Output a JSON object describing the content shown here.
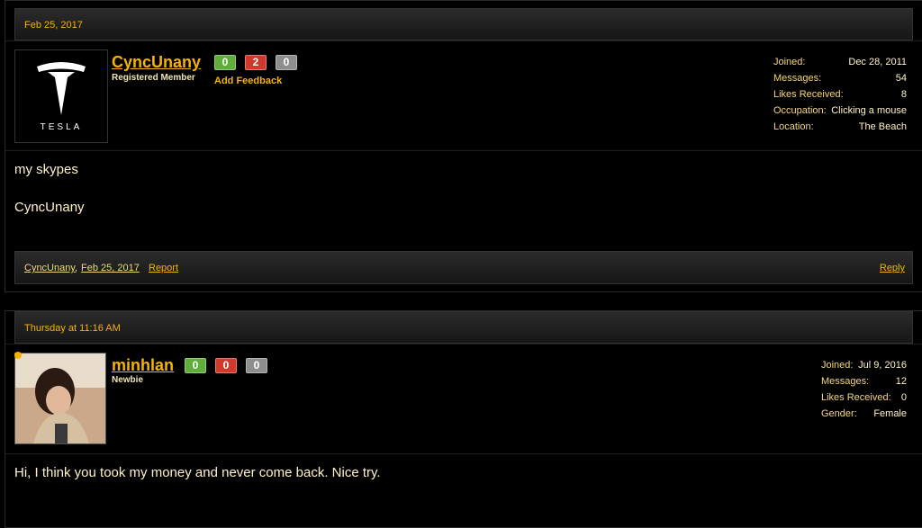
{
  "posts": [
    {
      "date": "Feb 25, 2017",
      "username": "CyncUnany",
      "role": "Registered Member",
      "avatar_label": "TESLA",
      "badges": [
        "0",
        "2",
        "0"
      ],
      "add_feedback": "Add Feedback",
      "stats": [
        {
          "label": "Joined:",
          "value": "Dec 28, 2011"
        },
        {
          "label": "Messages:",
          "value": "54"
        },
        {
          "label": "Likes Received:",
          "value": "8"
        },
        {
          "label": "Occupation:",
          "value": "Clicking a mouse"
        },
        {
          "label": "Location:",
          "value": "The Beach"
        }
      ],
      "message_lines": [
        "my skypes",
        "CyncUnany"
      ],
      "footer": {
        "author": "CyncUnany",
        "separator": ",",
        "date": "Feb 25, 2017",
        "report": "Report",
        "reply": "Reply"
      }
    },
    {
      "date": "Thursday at 11:16 AM",
      "username": "minhlan",
      "role": "Newbie",
      "badges": [
        "0",
        "0",
        "0"
      ],
      "stats": [
        {
          "label": "Joined:",
          "value": "Jul 9, 2016"
        },
        {
          "label": "Messages:",
          "value": "12"
        },
        {
          "label": "Likes Received:",
          "value": "0"
        },
        {
          "label": "Gender:",
          "value": "Female"
        }
      ],
      "message_lines": [
        "Hi, I think you took my money and never come back. Nice try."
      ]
    }
  ],
  "colors": {
    "accent": "#f5b400",
    "text": "#f2e6b5",
    "badge_green": "#5fae3a",
    "badge_red": "#d2392a",
    "badge_gray": "#8e8e8e"
  }
}
